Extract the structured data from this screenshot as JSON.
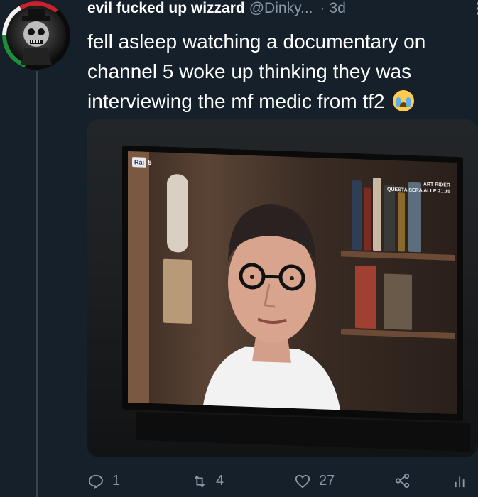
{
  "tweet": {
    "display_name": "evil fucked up wizzard",
    "handle": "@Dinky...",
    "separator": "·",
    "timestamp": "3d",
    "text": "fell asleep watching a documentary on channel 5 woke up thinking they was interviewing the mf medic from tf2",
    "emoji": "loudly-crying-face"
  },
  "media": {
    "channel_logo": "Rai",
    "channel_number": "5",
    "caption_line1": "ART RIDER",
    "caption_line2": "QUESTA SERA ALLE 21.15"
  },
  "actions": {
    "reply_count": "1",
    "retweet_count": "4",
    "like_count": "27"
  },
  "icons": {
    "reply": "reply-icon",
    "retweet": "retweet-icon",
    "like": "heart-icon",
    "share": "share-icon",
    "analytics": "analytics-icon",
    "more": "more-icon"
  },
  "colors": {
    "background": "#15202b",
    "secondary_text": "#8b98a5",
    "thread_line": "#38444d"
  }
}
